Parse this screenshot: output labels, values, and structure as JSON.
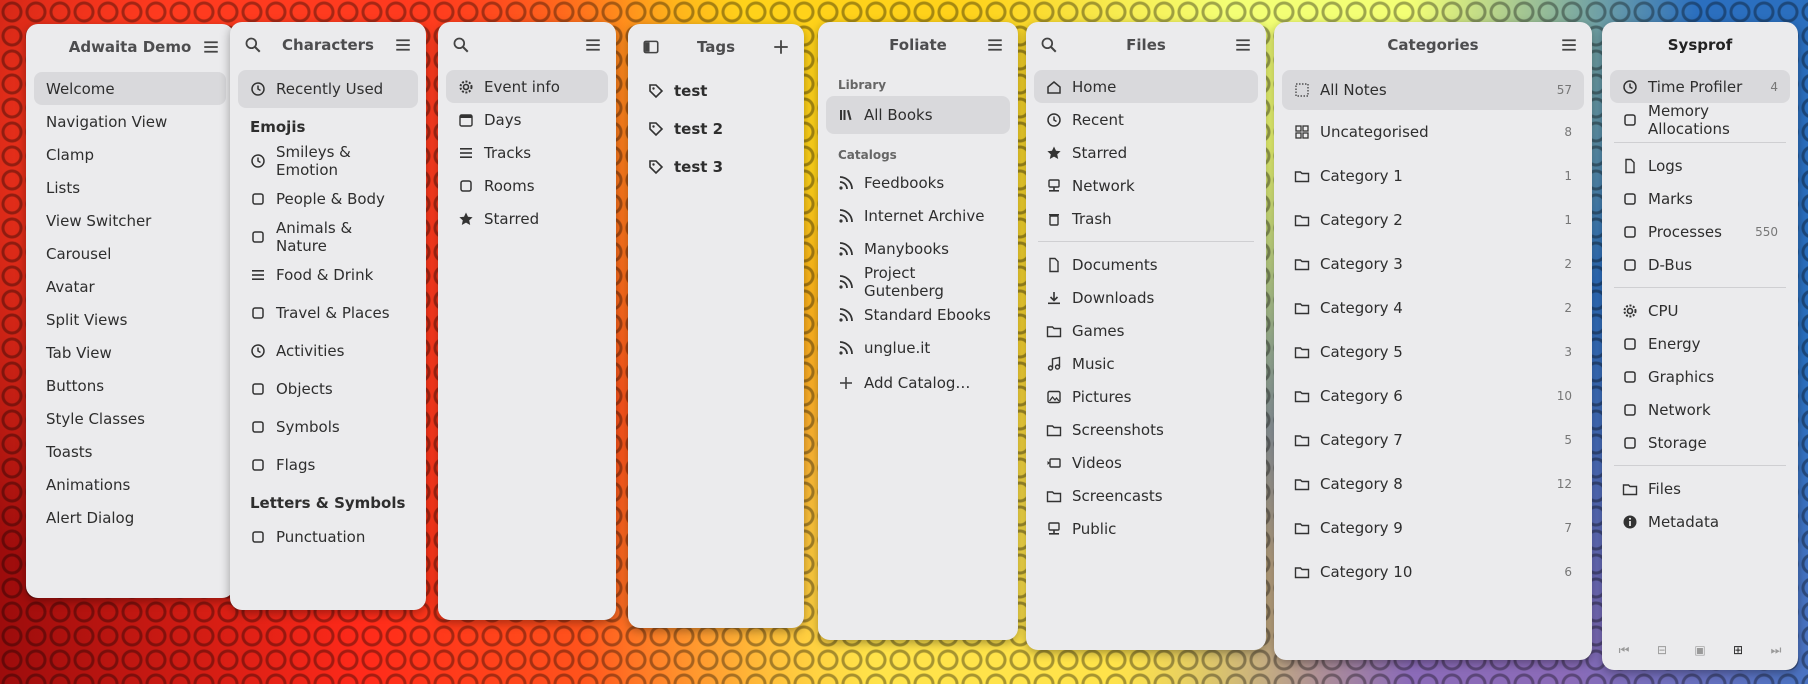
{
  "adwaita": {
    "title": "Adwaita Demo",
    "items": [
      "Welcome",
      "Navigation View",
      "Clamp",
      "Lists",
      "View Switcher",
      "Carousel",
      "Avatar",
      "Split Views",
      "Tab View",
      "Buttons",
      "Style Classes",
      "Toasts",
      "Animations",
      "Alert Dialog"
    ]
  },
  "characters": {
    "title": "Characters",
    "recent": "Recently Used",
    "emojis_header": "Emojis",
    "emojis": [
      {
        "label": "Smileys & Emotion",
        "icon": "smiley-icon"
      },
      {
        "label": "People & Body",
        "icon": "thumbs-up-icon"
      },
      {
        "label": "Animals & Nature",
        "icon": "leaf-icon"
      },
      {
        "label": "Food & Drink",
        "icon": "fork-knife-icon"
      },
      {
        "label": "Travel & Places",
        "icon": "car-icon"
      },
      {
        "label": "Activities",
        "icon": "ball-icon"
      },
      {
        "label": "Objects",
        "icon": "lightbulb-icon"
      },
      {
        "label": "Symbols",
        "icon": "symbols-icon"
      },
      {
        "label": "Flags",
        "icon": "flag-icon"
      }
    ],
    "letters_header": "Letters & Symbols",
    "punctuation": "Punctuation"
  },
  "events": {
    "items": [
      {
        "label": "Event info",
        "icon": "gear-icon"
      },
      {
        "label": "Days",
        "icon": "calendar-icon"
      },
      {
        "label": "Tracks",
        "icon": "list-icon"
      },
      {
        "label": "Rooms",
        "icon": "rooms-icon"
      },
      {
        "label": "Starred",
        "icon": "star-icon"
      }
    ]
  },
  "tags": {
    "title": "Tags",
    "items": [
      "test",
      "test 2",
      "test 3"
    ]
  },
  "foliate": {
    "title": "Foliate",
    "library_header": "Library",
    "all_books": "All Books",
    "catalogs_header": "Catalogs",
    "catalogs": [
      "Feedbooks",
      "Internet Archive",
      "Manybooks",
      "Project Gutenberg",
      "Standard Ebooks",
      "unglue.it"
    ],
    "add_catalog": "Add Catalog…"
  },
  "files": {
    "title": "Files",
    "places": [
      {
        "label": "Home",
        "icon": "home-icon"
      },
      {
        "label": "Recent",
        "icon": "clock-icon"
      },
      {
        "label": "Starred",
        "icon": "star-icon"
      },
      {
        "label": "Network",
        "icon": "network-icon"
      },
      {
        "label": "Trash",
        "icon": "trash-icon"
      }
    ],
    "folders": [
      {
        "label": "Documents",
        "icon": "document-icon"
      },
      {
        "label": "Downloads",
        "icon": "download-icon"
      },
      {
        "label": "Games",
        "icon": "folder-icon"
      },
      {
        "label": "Music",
        "icon": "music-icon"
      },
      {
        "label": "Pictures",
        "icon": "picture-icon"
      },
      {
        "label": "Screenshots",
        "icon": "folder-icon"
      },
      {
        "label": "Videos",
        "icon": "video-icon"
      },
      {
        "label": "Screencasts",
        "icon": "folder-icon"
      },
      {
        "label": "Public",
        "icon": "public-icon"
      }
    ]
  },
  "categories": {
    "title": "Categories",
    "all_notes": {
      "label": "All Notes",
      "count": "57"
    },
    "uncategorised": {
      "label": "Uncategorised",
      "count": "8"
    },
    "items": [
      {
        "label": "Category 1",
        "count": "1"
      },
      {
        "label": "Category 2",
        "count": "1"
      },
      {
        "label": "Category 3",
        "count": "2"
      },
      {
        "label": "Category 4",
        "count": "2"
      },
      {
        "label": "Category 5",
        "count": "3"
      },
      {
        "label": "Category 6",
        "count": "10"
      },
      {
        "label": "Category 7",
        "count": "5"
      },
      {
        "label": "Category 8",
        "count": "12"
      },
      {
        "label": "Category 9",
        "count": "7"
      },
      {
        "label": "Category 10",
        "count": "6"
      }
    ]
  },
  "sysprof": {
    "title": "Sysprof",
    "group1": [
      {
        "label": "Time Profiler",
        "count": "4",
        "icon": "timer-icon"
      },
      {
        "label": "Memory Allocations",
        "count": "",
        "icon": "memory-icon"
      }
    ],
    "group2": [
      {
        "label": "Logs",
        "count": "",
        "icon": "logs-icon"
      },
      {
        "label": "Marks",
        "count": "",
        "icon": "marks-icon"
      },
      {
        "label": "Processes",
        "count": "550",
        "icon": "processes-icon"
      },
      {
        "label": "D-Bus",
        "count": "",
        "icon": "dbus-icon"
      }
    ],
    "group3": [
      {
        "label": "CPU",
        "count": "",
        "icon": "cpu-icon"
      },
      {
        "label": "Energy",
        "count": "",
        "icon": "energy-icon"
      },
      {
        "label": "Graphics",
        "count": "",
        "icon": "graphics-icon"
      },
      {
        "label": "Network",
        "count": "",
        "icon": "network-arrows-icon"
      },
      {
        "label": "Storage",
        "count": "",
        "icon": "storage-icon"
      }
    ],
    "group4": [
      {
        "label": "Files",
        "count": "",
        "icon": "folder-icon"
      },
      {
        "label": "Metadata",
        "count": "",
        "icon": "info-icon"
      }
    ]
  }
}
